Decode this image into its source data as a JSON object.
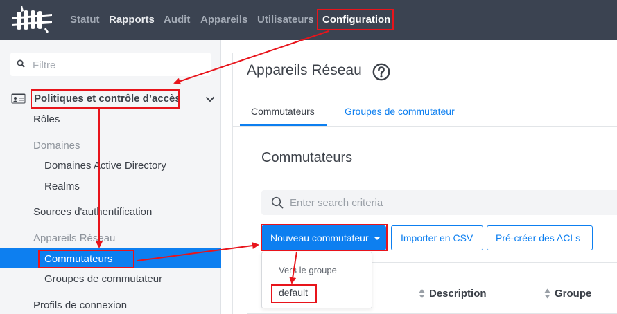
{
  "nav": {
    "items": [
      "Statut",
      "Rapports",
      "Audit",
      "Appareils",
      "Utilisateurs",
      "Configuration"
    ]
  },
  "sidebar": {
    "filter_placeholder": "Filtre",
    "section_title": "Politiques et contrôle d’accès",
    "items": {
      "roles": "Rôles",
      "domaines": "Domaines",
      "domaines_ad": "Domaines Active Directory",
      "realms": "Realms",
      "sources_auth": "Sources d'authentification",
      "appareils_reseau": "Appareils Réseau",
      "commutateurs": "Commutateurs",
      "groupes_commutateur": "Groupes de commutateur",
      "profils_connexion": "Profils de connexion"
    }
  },
  "main": {
    "page_title": "Appareils Réseau",
    "tabs": [
      "Commutateurs",
      "Groupes de commutateur"
    ],
    "card_title": "Commutateurs",
    "search_placeholder": "Enter search criteria",
    "buttons": {
      "new_switch": "Nouveau commutateur",
      "import_csv": "Importer en CSV",
      "precreate_acls": "Pré-créer des ACLs"
    },
    "dropdown": {
      "header": "Vers le groupe",
      "item": "default"
    },
    "table_headers": [
      "Description",
      "Groupe"
    ]
  },
  "colors": {
    "topbar": "#3b4351",
    "accent": "#0d7ff0",
    "annotation": "#e8141b"
  }
}
